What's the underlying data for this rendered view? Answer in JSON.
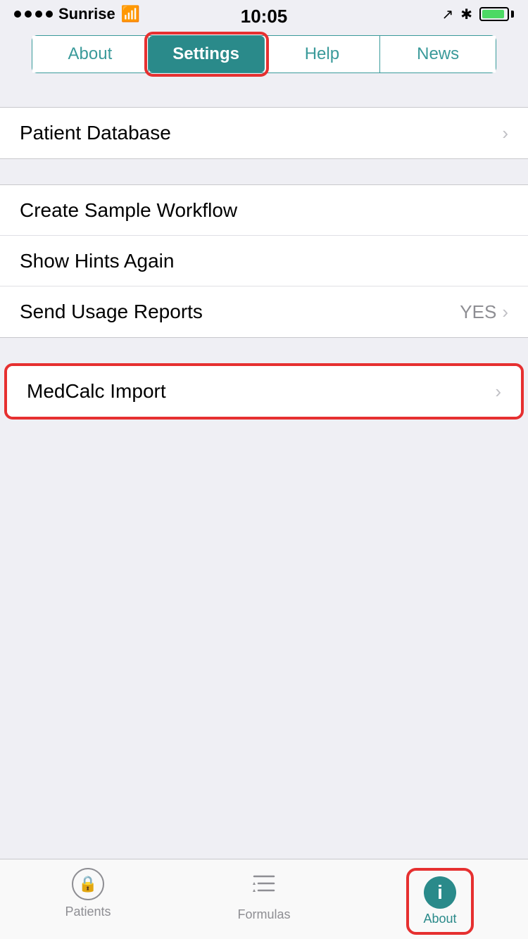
{
  "statusBar": {
    "carrier": "Sunrise",
    "time": "10:05",
    "dots": 4
  },
  "segmentedControl": {
    "tabs": [
      {
        "id": "about",
        "label": "About",
        "active": false
      },
      {
        "id": "settings",
        "label": "Settings",
        "active": true,
        "outlined": true
      },
      {
        "id": "help",
        "label": "Help",
        "active": false
      },
      {
        "id": "news",
        "label": "News",
        "active": false
      }
    ]
  },
  "sections": {
    "patientDatabase": {
      "label": "Patient Database",
      "chevron": "›"
    },
    "group2": [
      {
        "label": "Create Sample Workflow",
        "value": "",
        "chevron": ""
      },
      {
        "label": "Show Hints Again",
        "value": "",
        "chevron": ""
      },
      {
        "label": "Send Usage Reports",
        "value": "YES",
        "chevron": "›"
      }
    ],
    "medcalcImport": {
      "label": "MedCalc Import",
      "chevron": "›",
      "outlined": true
    }
  },
  "tabBar": {
    "items": [
      {
        "id": "patients",
        "label": "Patients",
        "icon": "lock",
        "active": false
      },
      {
        "id": "formulas",
        "label": "Formulas",
        "icon": "stars",
        "active": false
      },
      {
        "id": "about",
        "label": "About",
        "icon": "info",
        "active": true,
        "outlined": true
      }
    ]
  }
}
